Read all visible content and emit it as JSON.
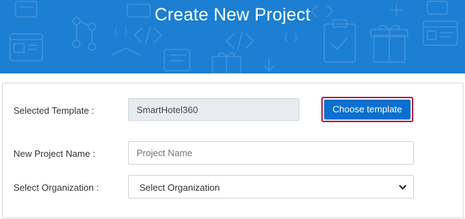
{
  "header": {
    "title": "Create New Project"
  },
  "form": {
    "template": {
      "label": "Selected Template :",
      "value": "SmartHotel360",
      "button_label": "Choose template"
    },
    "project_name": {
      "label": "New Project Name :",
      "placeholder": "Project Name",
      "value": ""
    },
    "organization": {
      "label": "Select Organization :",
      "selected": "Select Organization"
    }
  },
  "colors": {
    "header_bg": "#1d7fd1",
    "button_bg": "#0a6fd0",
    "button_focus_border": "#a5214f"
  }
}
